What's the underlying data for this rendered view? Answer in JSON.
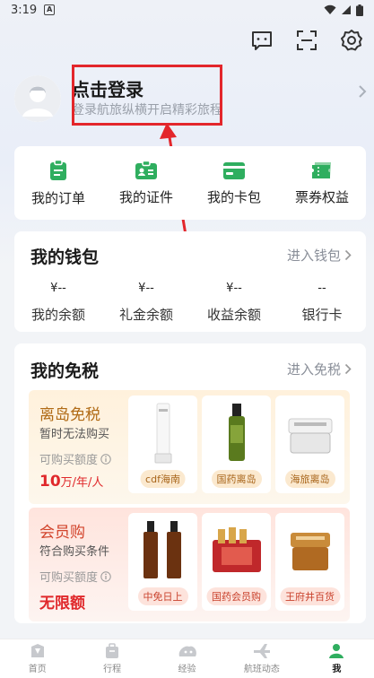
{
  "status_bar": {
    "time": "3:19",
    "badge": "A"
  },
  "header": {
    "icons": [
      "message-icon",
      "scan-icon",
      "settings-icon"
    ]
  },
  "login": {
    "title": "点击登录",
    "subtitle": "登录航旅纵横开启精彩旅程"
  },
  "quick_menu": [
    {
      "label": "我的订单",
      "icon": "order-icon"
    },
    {
      "label": "我的证件",
      "icon": "id-card-icon"
    },
    {
      "label": "我的卡包",
      "icon": "card-wallet-icon"
    },
    {
      "label": "票券权益",
      "icon": "ticket-icon"
    }
  ],
  "wallet": {
    "title": "我的钱包",
    "link": "进入钱包",
    "items": [
      {
        "value": "¥--",
        "label": "我的余额"
      },
      {
        "value": "¥--",
        "label": "礼金余额"
      },
      {
        "value": "¥--",
        "label": "收益余额"
      },
      {
        "value": "--",
        "label": "银行卡"
      }
    ]
  },
  "duty_free": {
    "title": "我的免税",
    "link": "进入免税",
    "panels": [
      {
        "title": "离岛免税",
        "desc": "暂时无法购买",
        "label": "可购买额度",
        "value_big": "10",
        "value_small": "万/年/人",
        "products": [
          "cdf海南",
          "国药离岛",
          "海旅离岛"
        ]
      },
      {
        "title": "会员购",
        "desc": "符合购买条件",
        "label": "可购买额度",
        "value_big": "无限额",
        "value_small": "",
        "products": [
          "中免日上",
          "国药会员购",
          "王府井百货"
        ]
      }
    ]
  },
  "tabbar": [
    {
      "label": "首页",
      "icon": "home-icon",
      "active": false
    },
    {
      "label": "行程",
      "icon": "trip-icon",
      "active": false
    },
    {
      "label": "经验",
      "icon": "experience-icon",
      "active": false
    },
    {
      "label": "航班动态",
      "icon": "flight-icon",
      "active": false
    },
    {
      "label": "我",
      "icon": "profile-icon",
      "active": true
    }
  ],
  "colors": {
    "accent_green": "#2fae5f",
    "red_annotation": "#e3262b",
    "price_red": "#e0282b"
  }
}
